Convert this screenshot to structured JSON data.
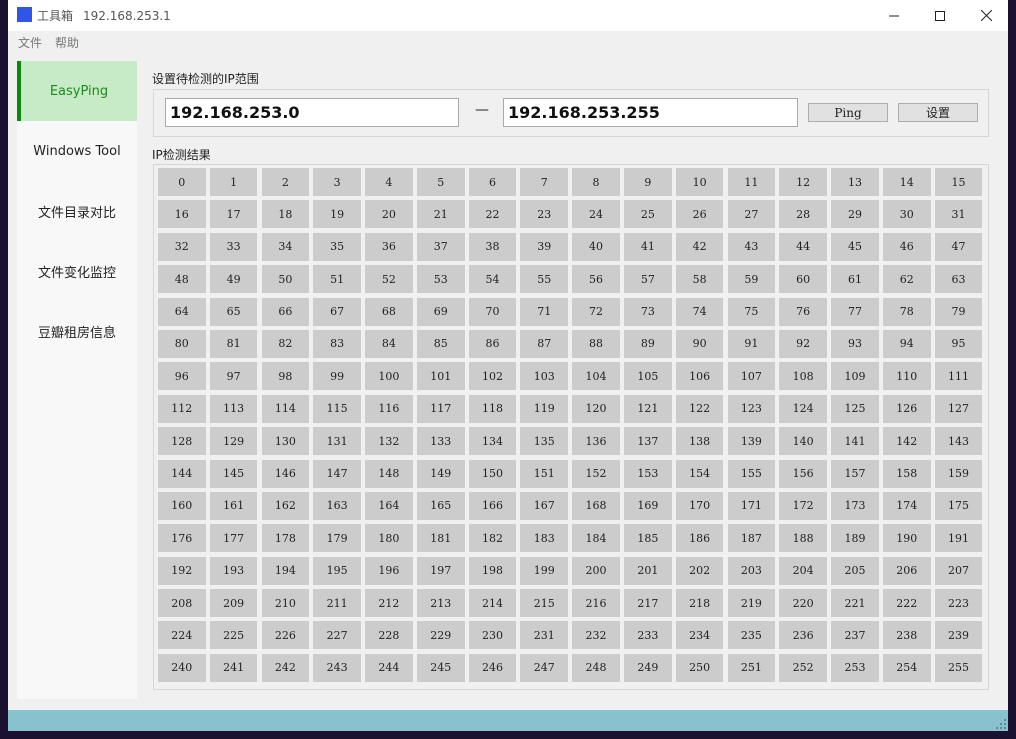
{
  "window": {
    "app_title": "工具箱",
    "ip_title": "192.168.253.1",
    "icon": "app-square-icon",
    "accent": "#2f56e6"
  },
  "menu": {
    "file": "文件",
    "help": "帮助"
  },
  "sidebar": {
    "items": [
      {
        "label": "EasyPing",
        "active": true
      },
      {
        "label": "Windows Tool",
        "active": false
      },
      {
        "label": "文件目录对比",
        "active": false
      },
      {
        "label": "文件变化监控",
        "active": false
      },
      {
        "label": "豆瓣租房信息",
        "active": false
      }
    ],
    "active_bg": "#c6ebc6",
    "active_border": "#0a8a0a"
  },
  "range": {
    "label": "设置待检测的IP范围",
    "start": "192.168.253.0",
    "end": "192.168.253.255",
    "dash": "—",
    "ping_label": "Ping",
    "settings_label": "设置"
  },
  "results": {
    "label": "IP检测结果",
    "cells": [
      "0",
      "1",
      "2",
      "3",
      "4",
      "5",
      "6",
      "7",
      "8",
      "9",
      "10",
      "11",
      "12",
      "13",
      "14",
      "15",
      "16",
      "17",
      "18",
      "19",
      "20",
      "21",
      "22",
      "23",
      "24",
      "25",
      "26",
      "27",
      "28",
      "29",
      "30",
      "31",
      "32",
      "33",
      "34",
      "35",
      "36",
      "37",
      "38",
      "39",
      "40",
      "41",
      "42",
      "43",
      "44",
      "45",
      "46",
      "47",
      "48",
      "49",
      "50",
      "51",
      "52",
      "53",
      "54",
      "55",
      "56",
      "57",
      "58",
      "59",
      "60",
      "61",
      "62",
      "63",
      "64",
      "65",
      "66",
      "67",
      "68",
      "69",
      "70",
      "71",
      "72",
      "73",
      "74",
      "75",
      "76",
      "77",
      "78",
      "79",
      "80",
      "81",
      "82",
      "83",
      "84",
      "85",
      "86",
      "87",
      "88",
      "89",
      "90",
      "91",
      "92",
      "93",
      "94",
      "95",
      "96",
      "97",
      "98",
      "99",
      "100",
      "101",
      "102",
      "103",
      "104",
      "105",
      "106",
      "107",
      "108",
      "109",
      "110",
      "111",
      "112",
      "113",
      "114",
      "115",
      "116",
      "117",
      "118",
      "119",
      "120",
      "121",
      "122",
      "123",
      "124",
      "125",
      "126",
      "127",
      "128",
      "129",
      "130",
      "131",
      "132",
      "133",
      "134",
      "135",
      "136",
      "137",
      "138",
      "139",
      "140",
      "141",
      "142",
      "143",
      "144",
      "145",
      "146",
      "147",
      "148",
      "149",
      "150",
      "151",
      "152",
      "153",
      "154",
      "155",
      "156",
      "157",
      "158",
      "159",
      "160",
      "161",
      "162",
      "163",
      "164",
      "165",
      "166",
      "167",
      "168",
      "169",
      "170",
      "171",
      "172",
      "173",
      "174",
      "175",
      "176",
      "177",
      "178",
      "179",
      "180",
      "181",
      "182",
      "183",
      "184",
      "185",
      "186",
      "187",
      "188",
      "189",
      "190",
      "191",
      "192",
      "193",
      "194",
      "195",
      "196",
      "197",
      "198",
      "199",
      "200",
      "201",
      "202",
      "203",
      "204",
      "205",
      "206",
      "207",
      "208",
      "209",
      "210",
      "211",
      "212",
      "213",
      "214",
      "215",
      "216",
      "217",
      "218",
      "219",
      "220",
      "221",
      "222",
      "223",
      "224",
      "225",
      "226",
      "227",
      "228",
      "229",
      "230",
      "231",
      "232",
      "233",
      "234",
      "235",
      "236",
      "237",
      "238",
      "239",
      "240",
      "241",
      "242",
      "243",
      "244",
      "245",
      "246",
      "247",
      "248",
      "249",
      "250",
      "251",
      "252",
      "253",
      "254",
      "255"
    ],
    "cell_color": "#cccccc"
  },
  "statusbar": {
    "color": "#88c2cf"
  }
}
